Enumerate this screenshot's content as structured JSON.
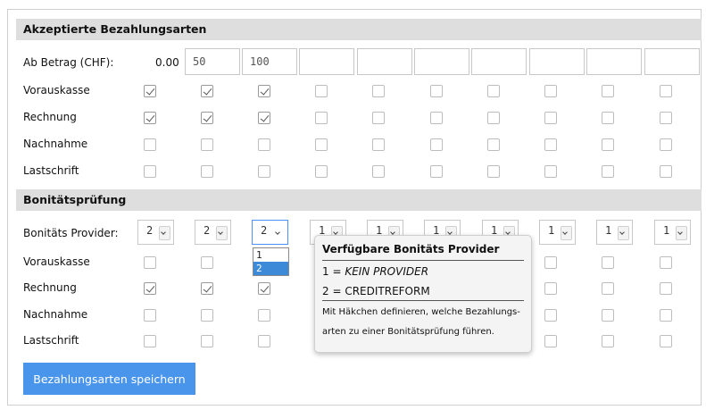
{
  "accepted_section": {
    "title": "Akzeptierte Bezahlungsarten",
    "amount_label": "Ab Betrag (CHF):",
    "first_amount": "0.00",
    "amount_inputs": [
      "50",
      "100",
      "",
      "",
      "",
      "",
      "",
      "",
      ""
    ],
    "rows": [
      {
        "label": "Vorauskasse",
        "checked": [
          true,
          true,
          true,
          false,
          false,
          false,
          false,
          false,
          false,
          false
        ]
      },
      {
        "label": "Rechnung",
        "checked": [
          true,
          true,
          true,
          false,
          false,
          false,
          false,
          false,
          false,
          false
        ]
      },
      {
        "label": "Nachnahme",
        "checked": [
          false,
          false,
          false,
          false,
          false,
          false,
          false,
          false,
          false,
          false
        ]
      },
      {
        "label": "Lastschrift",
        "checked": [
          false,
          false,
          false,
          false,
          false,
          false,
          false,
          false,
          false,
          false
        ]
      }
    ]
  },
  "credit_section": {
    "title": "Bonitätsprüfung",
    "provider_label": "Bonitäts Provider:",
    "providers": [
      "2",
      "2",
      "2",
      "1",
      "1",
      "1",
      "1",
      "1",
      "1",
      "1"
    ],
    "dropdown_options": [
      "1",
      "2"
    ],
    "dropdown_selected": "2",
    "rows": [
      {
        "label": "Vorauskasse",
        "checked": [
          false,
          false,
          false,
          false,
          false,
          false,
          false,
          false,
          false,
          false
        ]
      },
      {
        "label": "Rechnung",
        "checked": [
          true,
          true,
          true,
          false,
          false,
          false,
          false,
          false,
          false,
          false
        ]
      },
      {
        "label": "Nachnahme",
        "checked": [
          false,
          false,
          false,
          false,
          false,
          false,
          false,
          false,
          false,
          false
        ]
      },
      {
        "label": "Lastschrift",
        "checked": [
          false,
          false,
          false,
          false,
          false,
          false,
          false,
          false,
          false,
          false
        ]
      }
    ]
  },
  "tooltip": {
    "title": "Verfügbare Bonitäts Provider",
    "line1_prefix": "1 = ",
    "line1_value": "KEIN PROVIDER",
    "line2": "2 = CREDITREFORM",
    "note_line1": "Mit Häkchen definieren, welche Bezahlungs-",
    "note_line2": "arten zu einer Bonitätsprüfung führen."
  },
  "save_button": {
    "label": "Bezahlungsarten speichern"
  },
  "colors": {
    "accent": "#4a95ec",
    "header_bg": "#dedede",
    "selected_option": "#3d8bd8"
  }
}
